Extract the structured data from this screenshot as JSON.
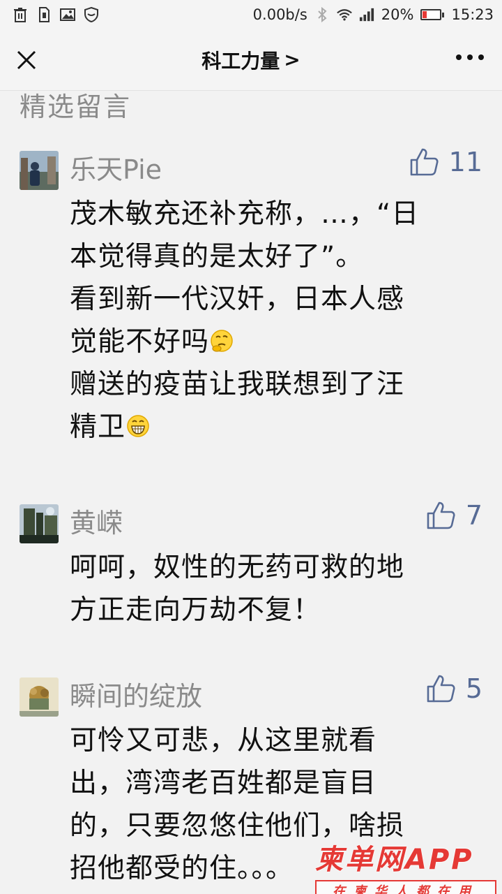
{
  "status_bar": {
    "net_speed": "0.00b/s",
    "battery_percent": "20%",
    "time": "15:23",
    "battery_level": 0.2,
    "icons": [
      "trash-icon",
      "sim-icon",
      "image-icon",
      "shield-icon",
      "bluetooth-icon",
      "wifi-icon",
      "signal-icon",
      "battery-icon"
    ]
  },
  "nav": {
    "title": "科工力量",
    "title_chevron": ">"
  },
  "section": {
    "title": "精选留言"
  },
  "comments": [
    {
      "user": "乐天Pie",
      "likes": "11",
      "lines": [
        "茂木敏充还补充称，…，“日",
        "本觉得真的是太好了”。",
        "看到新一代汉奸，日本人感",
        "觉能不好吗",
        "赠送的疫苗让我联想到了汪",
        "精卫"
      ]
    },
    {
      "user": "黄嵘",
      "likes": "7",
      "lines": [
        "呵呵，奴性的无药可救的地",
        "方正走向万劫不复！"
      ]
    },
    {
      "user": "瞬间的绽放",
      "likes": "5",
      "lines": [
        "可怜又可悲，从这里就看",
        "出，湾湾老百姓都是盲目",
        "的，只要忽悠住他们，啥损",
        "招他都受的住。。。"
      ]
    }
  ],
  "watermark": {
    "logo": "柬单网APP",
    "tagline": "在柬华人都在用"
  },
  "colors": {
    "accent": "#576b95",
    "muted_text": "#8a8a8a",
    "watermark": "#e53935",
    "battery_low": "#e53935"
  }
}
